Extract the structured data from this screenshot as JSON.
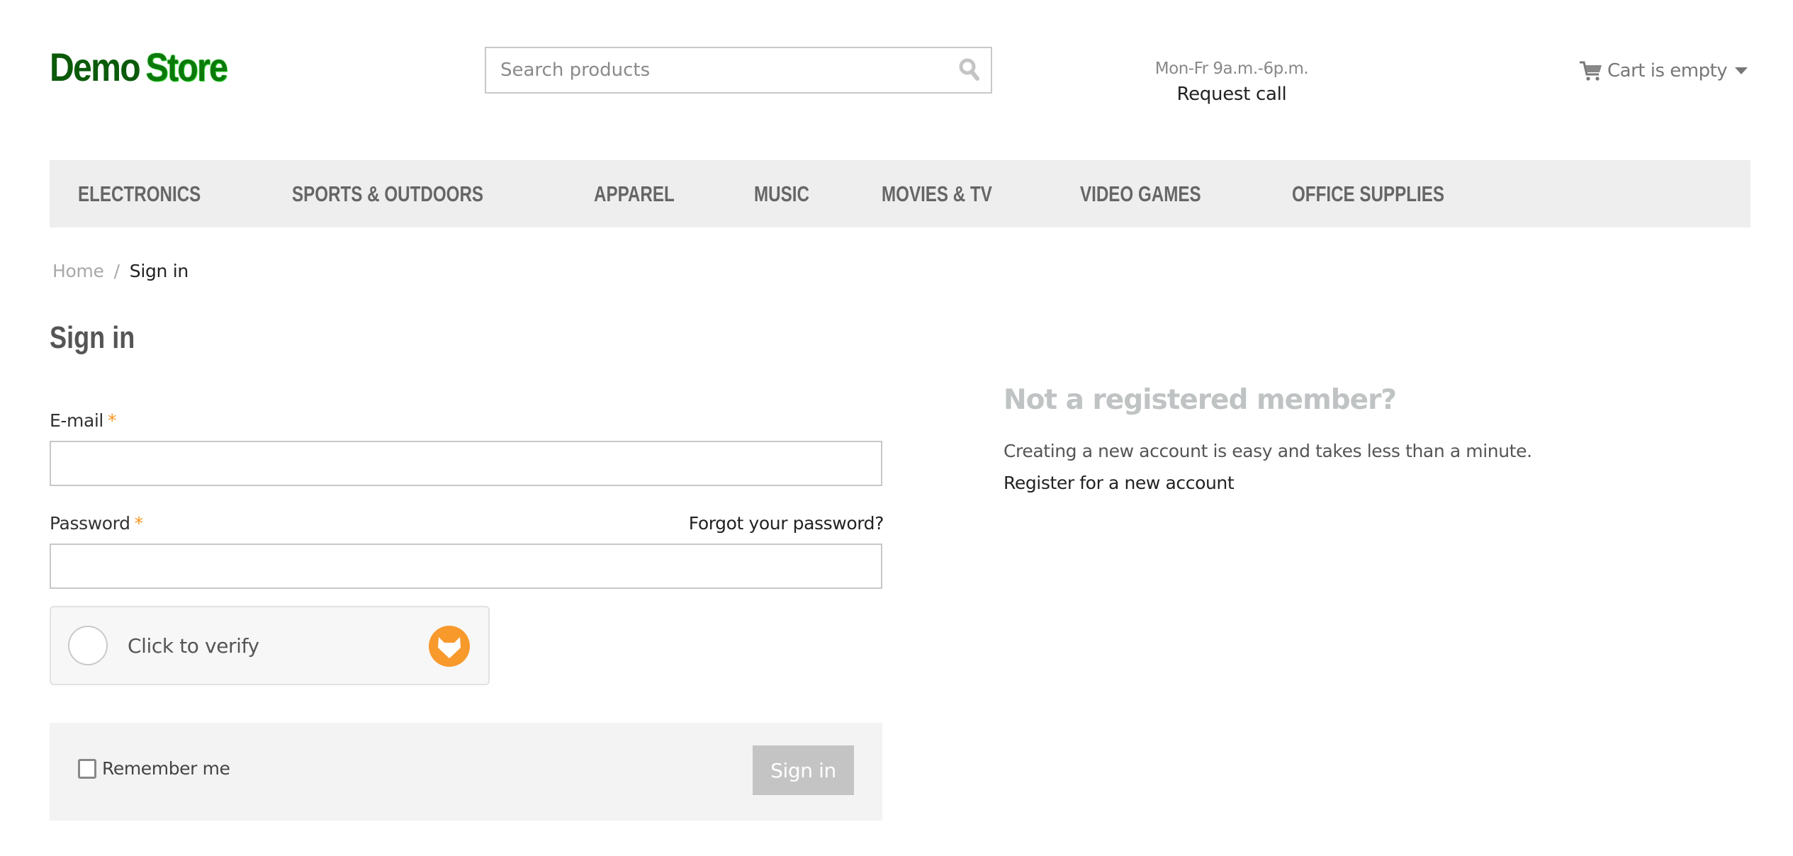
{
  "header": {
    "logo": {
      "part1": "Demo",
      "part2": "Store"
    },
    "search": {
      "placeholder": "Search products",
      "value": "",
      "icon": "search-icon"
    },
    "hours": "Mon-Fr 9a.m.-6p.m.",
    "request_call": "Request call",
    "cart": {
      "label": "Cart is empty",
      "icon": "cart-icon",
      "dropdown_icon": "caret-down-icon"
    }
  },
  "nav": {
    "items": [
      {
        "label": "ELECTRONICS"
      },
      {
        "label": "SPORTS & OUTDOORS"
      },
      {
        "label": "APPAREL"
      },
      {
        "label": "MUSIC"
      },
      {
        "label": "MOVIES & TV"
      },
      {
        "label": "VIDEO GAMES"
      },
      {
        "label": "OFFICE SUPPLIES"
      }
    ]
  },
  "breadcrumb": {
    "home": "Home",
    "separator": "/",
    "current": "Sign in"
  },
  "page_title": "Sign in",
  "form": {
    "email": {
      "label": "E-mail",
      "required_marker": "*",
      "value": ""
    },
    "password": {
      "label": "Password",
      "required_marker": "*",
      "value": ""
    },
    "forgot_password": "Forgot your password?",
    "captcha": {
      "label": "Click to verify",
      "icon": "fox-logo-icon"
    },
    "remember_me": {
      "label": "Remember me",
      "checked": false
    },
    "submit": {
      "label": "Sign in",
      "disabled": true
    }
  },
  "register": {
    "title": "Not a registered member?",
    "text": "Creating a new account is easy and takes less than a minute.",
    "link": "Register for a new account"
  },
  "colors": {
    "logo_dark_green": "#0a5a0a",
    "logo_green": "#0b7a0b",
    "nav_bg": "#eeeeee",
    "required_orange": "#f7941d",
    "captcha_orange": "#f8992c",
    "button_disabled": "#c4c4c4",
    "register_title": "#bfc3c3"
  }
}
